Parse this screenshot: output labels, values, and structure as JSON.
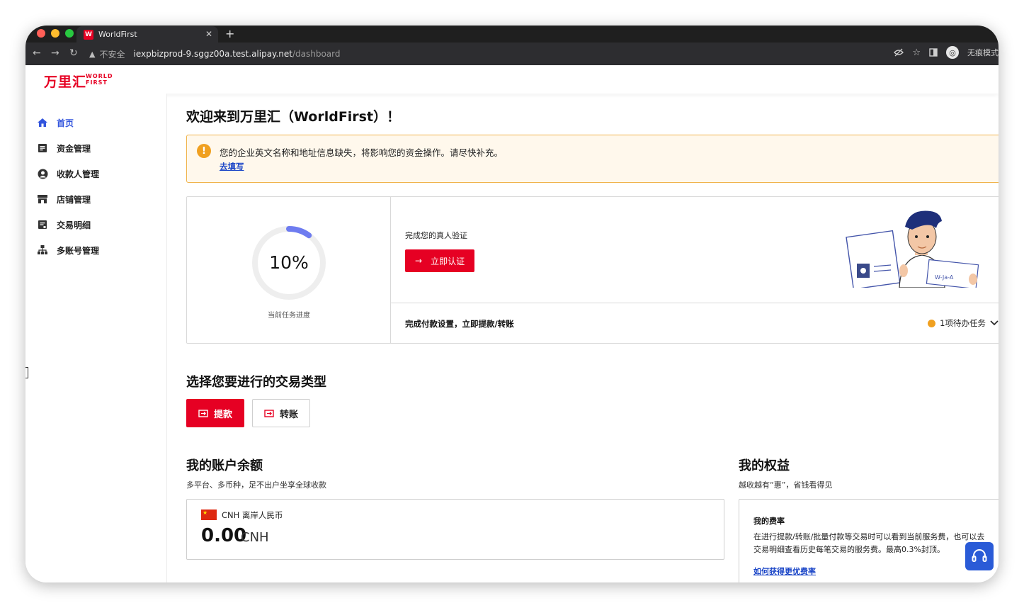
{
  "browser": {
    "tab_title": "WorldFirst",
    "tab_favicon": "W",
    "new_tab": "+",
    "security_label": "不安全",
    "url_host": "iexpbizprod-9.sggz00a.test.alipay.net",
    "url_path": "/dashboard",
    "incognito_label": "无痕模式",
    "traffic_colors": [
      "#ff5f57",
      "#febc2e",
      "#28c840"
    ]
  },
  "brand": {
    "cn": "万里汇",
    "en_line1": "WORLD",
    "en_line2": "FIRST",
    "color": "#e60023"
  },
  "sidebar": {
    "items": [
      {
        "label": "首页",
        "icon": "home-icon",
        "active": true
      },
      {
        "label": "资金管理",
        "icon": "ledger-icon"
      },
      {
        "label": "收款人管理",
        "icon": "person-icon"
      },
      {
        "label": "店铺管理",
        "icon": "store-icon"
      },
      {
        "label": "交易明细",
        "icon": "receipt-icon"
      },
      {
        "label": "多账号管理",
        "icon": "org-chart-icon"
      }
    ]
  },
  "main": {
    "welcome": "欢迎来到万里汇（WorldFirst）！",
    "alert": {
      "message": "您的企业英文名称和地址信息缺失，将影响您的资金操作。请尽快补充。",
      "link": "去填写"
    },
    "task": {
      "progress_value": 10,
      "progress_text": "10%",
      "progress_label": "当前任务进度",
      "verify_title": "完成您的真人验证",
      "verify_button": "立即认证",
      "payment_title": "完成付款设置，立即提款/转账",
      "pending": "1项待办任务"
    },
    "tx_section": {
      "title": "选择您要进行的交易类型",
      "withdraw": "提款",
      "transfer": "转账"
    },
    "balance": {
      "title": "我的账户余额",
      "subtitle": "多平台、多币种，足不出户坐享全球收款",
      "currency_label": "CNH 离岸人民币",
      "amount": "0.00",
      "currency": "CNH"
    },
    "benefits": {
      "title": "我的权益",
      "subtitle": "越收越有“惠”，省钱看得见",
      "card_title": "我的费率",
      "card_text": "在进行提款/转账/批量付款等交易时可以看到当前服务费，也可以去交易明细查看历史每笔交易的服务费。最高0.3%封顶。",
      "card_link": "如何获得更优费率"
    }
  },
  "colors": {
    "primary": "#e60023",
    "active_nav": "#3355dd",
    "link": "#1a45c7",
    "warning": "#f0a020",
    "progress": "#6e7cf0"
  }
}
